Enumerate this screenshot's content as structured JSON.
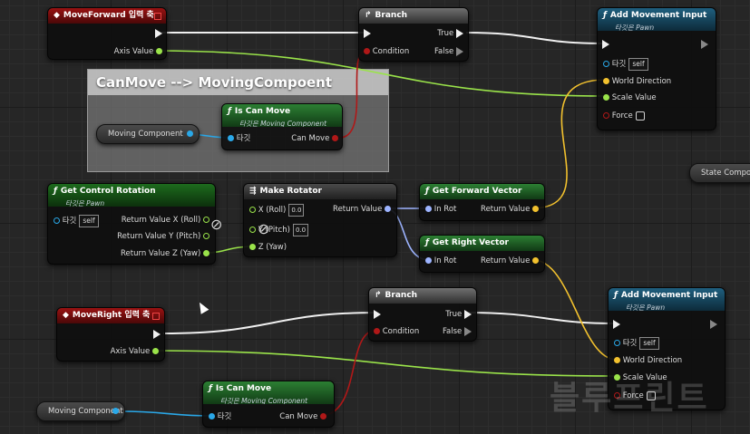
{
  "canvas": {
    "watermark": "블루프린트"
  },
  "comment": {
    "title": "CanMove --> MovingCompoent"
  },
  "nodes": {
    "moveforward": {
      "title": "MoveForward 입력 축",
      "axis_label": "Axis Value"
    },
    "branch1": {
      "title": "Branch",
      "condition": "Condition",
      "true": "True",
      "false": "False"
    },
    "addmove1": {
      "title": "Add Movement Input",
      "subtitle": "타깃은 Pawn",
      "target": "타깃",
      "self": "self",
      "world_direction": "World Direction",
      "scale_value": "Scale Value",
      "force": "Force"
    },
    "iscanmove1": {
      "title": "Is Can Move",
      "subtitle": "타깃은 Moving Component",
      "target": "타깃",
      "can_move": "Can Move"
    },
    "moving_var1": {
      "label": "Moving Component"
    },
    "getcontrol": {
      "title": "Get Control Rotation",
      "subtitle": "타깃은 Pawn",
      "target": "타깃",
      "self": "self",
      "roll": "Return Value X (Roll)",
      "pitch": "Return Value Y (Pitch)",
      "yaw": "Return Value Z (Yaw)"
    },
    "makerot": {
      "title": "Make Rotator",
      "x": "X (Roll)",
      "y": "Y (Pitch)",
      "z": "Z (Yaw)",
      "x_val": "0.0",
      "y_val": "0.0",
      "return": "Return Value"
    },
    "getforward": {
      "title": "Get Forward Vector",
      "in_rot": "In Rot",
      "return": "Return Value"
    },
    "getright": {
      "title": "Get Right Vector",
      "in_rot": "In Rot",
      "return": "Return Value"
    },
    "state_comp": {
      "label": "State Compon"
    },
    "moveright": {
      "title": "MoveRight 입력 축",
      "axis_label": "Axis Value"
    },
    "branch2": {
      "title": "Branch",
      "condition": "Condition",
      "true": "True",
      "false": "False"
    },
    "addmove2": {
      "title": "Add Movement Input",
      "subtitle": "타깃은 Pawn",
      "target": "타깃",
      "self": "self",
      "world_direction": "World Direction",
      "scale_value": "Scale Value",
      "force": "Force"
    },
    "iscanmove2": {
      "title": "Is Can Move",
      "subtitle": "타깃은 Moving Component",
      "target": "타깃",
      "can_move": "Can Move"
    },
    "moving_var2": {
      "label": "Moving Component"
    }
  },
  "colors": {
    "exec": "#f0f0f0",
    "float": "#9ae34a",
    "bool": "#b01818",
    "object": "#2aa8e8",
    "vector": "#f2c12e",
    "rotator": "#9db4ff"
  }
}
